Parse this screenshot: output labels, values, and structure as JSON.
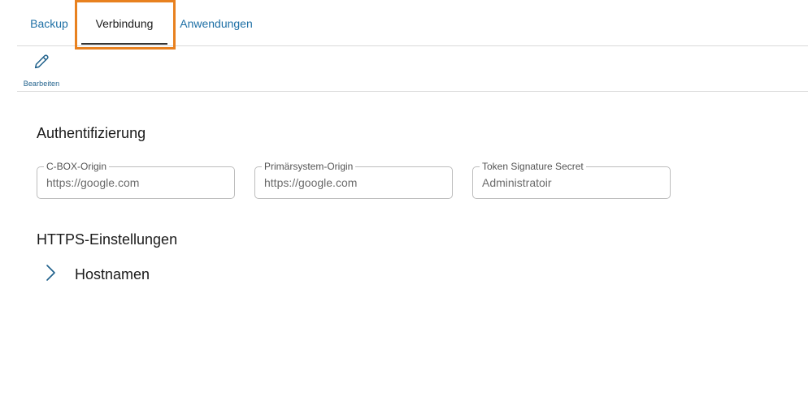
{
  "tabs": [
    {
      "label": "Backup",
      "active": false
    },
    {
      "label": "Verbindung",
      "active": true
    },
    {
      "label": "Anwendungen",
      "active": false
    }
  ],
  "toolbar": {
    "edit_label": "Bearbeiten",
    "edit_icon": "pencil-icon"
  },
  "authentication": {
    "title": "Authentifizierung",
    "fields": [
      {
        "label": "C-BOX-Origin",
        "value": "https://google.com"
      },
      {
        "label": "Primärsystem-Origin",
        "value": "https://google.com"
      },
      {
        "label": "Token Signature Secret",
        "value": "Administratoir"
      }
    ]
  },
  "https": {
    "title": "HTTPS-Einstellungen",
    "hostnames_label": "Hostnamen",
    "expander_icon": "chevron-right-icon"
  },
  "colors": {
    "accent": "#1d6fa5",
    "focus_outline": "#e8811f",
    "border": "#bdbdbd"
  }
}
